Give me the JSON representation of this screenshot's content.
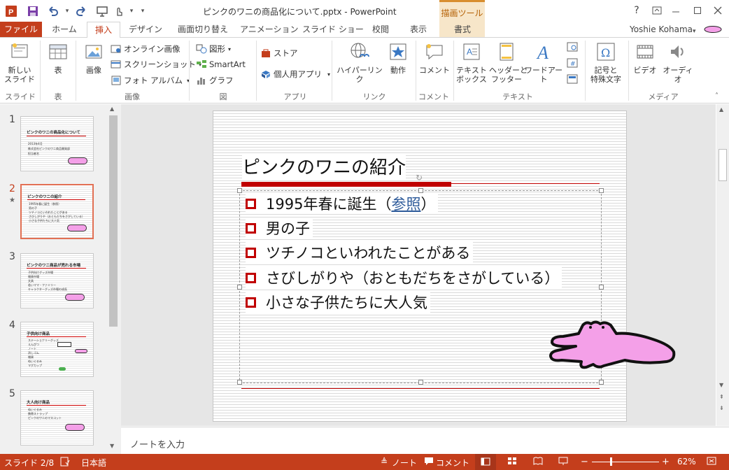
{
  "app": {
    "title": "ピンクのワニの商品化について.pptx - PowerPoint",
    "contextual_group": "描画ツール",
    "user": "Yoshie Kohama",
    "help": "?",
    "colors": {
      "accent": "#c43e1c",
      "title_red": "#c00000",
      "link": "#2e5b9a",
      "croc_pink": "#f4a0e8"
    }
  },
  "qat": {
    "icons": [
      "powerpoint-logo-icon",
      "save-icon",
      "undo-icon",
      "redo-icon",
      "present-icon",
      "touch-mode-icon",
      "customize-icon"
    ]
  },
  "tabs": [
    {
      "label": "ファイル"
    },
    {
      "label": "ホーム"
    },
    {
      "label": "挿入"
    },
    {
      "label": "デザイン"
    },
    {
      "label": "画面切り替え"
    },
    {
      "label": "アニメーション"
    },
    {
      "label": "スライド ショー"
    },
    {
      "label": "校閲"
    },
    {
      "label": "表示"
    },
    {
      "label": "書式"
    }
  ],
  "ribbon": {
    "new_slide": "新しい\nスライド",
    "table": "表",
    "image": "画像",
    "online_image": "オンライン画像",
    "screenshot": "スクリーンショット",
    "photo_album": "フォト アルバム",
    "shapes": "図形",
    "smartart": "SmartArt",
    "chart": "グラフ",
    "store": "ストア",
    "personal_apps": "個人用アプリ",
    "hyperlink": "ハイパーリンク",
    "action": "動作",
    "comment": "コメント",
    "textbox": "テキスト\nボックス",
    "header_footer": "ヘッダーと\nフッター",
    "wordart": "ワードアート",
    "symbol": "記号と\n特殊文字",
    "video": "ビデオ",
    "audio": "オーディオ",
    "groups": {
      "slides": "スライド",
      "tables": "表",
      "images": "画像",
      "illustrations": "図",
      "apps": "アプリ",
      "links": "リンク",
      "comments": "コメント",
      "text": "テキスト",
      "media": "メディア"
    }
  },
  "thumbnails": [
    {
      "number": "1",
      "title": "ピンクのワニの商品化について",
      "lines": [
        "2013年4月",
        "株式会社ピンクのワニ商品開発部",
        "担当者名"
      ]
    },
    {
      "number": "2",
      "title": "ピンクのワニの紹介",
      "lines": [
        "1995年春に誕生（参照）",
        "男の子",
        "ツチノコといわれたことがある",
        "さびしがりや（おともだちをさがしている）",
        "小さな子供たちに大人気"
      ]
    },
    {
      "number": "3",
      "title": "ピンクのワニ商品が売れる市場",
      "lines": [
        "子供向けグッズ市場",
        "雑貨市場",
        "文具",
        "若いママ・ファミリー",
        "キャラクターグッズ市場の成長"
      ]
    },
    {
      "number": "4",
      "title": "子供向け商品",
      "lines": [
        "ステーショナリーグッズ",
        "えんぴつ",
        "ノート",
        "消しゴム",
        "雑貨",
        "ぬいぐるみ",
        "マグカップ"
      ]
    },
    {
      "number": "5",
      "title": "大人向け商品",
      "lines": [
        "ぬいぐるみ",
        "携帯ストラップ",
        "ピンクのワニのマスコット"
      ]
    }
  ],
  "slide": {
    "title": "ピンクのワニの紹介",
    "bullets": [
      {
        "text": "1995年春に誕生（",
        "link": "参照",
        "after": "）"
      },
      {
        "text": "男の子"
      },
      {
        "text": "ツチノコといわれたことがある"
      },
      {
        "text": "さびしがりや（おともだちをさがしている）"
      },
      {
        "text": "小さな子供たちに大人気"
      }
    ]
  },
  "notes": {
    "placeholder": "ノートを入力"
  },
  "status": {
    "slide": "スライド 2/8",
    "language": "日本語",
    "notes_button": "ノート",
    "comments_button": "コメント",
    "zoom": "62%"
  }
}
